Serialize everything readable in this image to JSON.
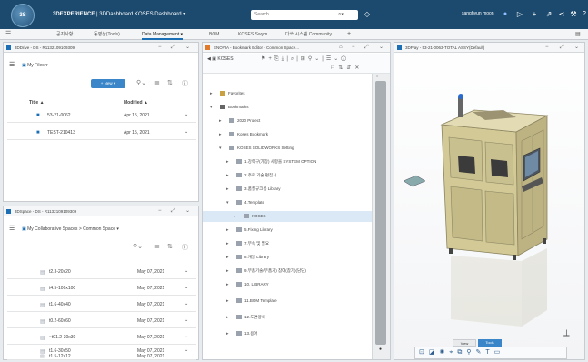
{
  "topbar": {
    "logo_text": "3S",
    "brand_strong": "3DEXPERIENCE",
    "brand_rest": " | 3DDashboard  KOSES Dashboard ▾",
    "search_placeholder": "Search",
    "user_name": "sanghyun moon"
  },
  "tabs": [
    {
      "label": "공지사항"
    },
    {
      "label": "동영상(Tools)"
    },
    {
      "label": "Data Management  ▾"
    },
    {
      "label": "BOM"
    },
    {
      "label": "KOSES Swym"
    },
    {
      "label": "다쏘 시스템 Community"
    },
    {
      "label": "+"
    }
  ],
  "drive_panel": {
    "title": "3DDrive - DS - R1132109109309",
    "files_label": "My Files ▾",
    "new_button": "+ New ▾",
    "col_title": "Title ▲",
    "col_modified": "Modified ▲",
    "rows": [
      {
        "title": "53-21-0062",
        "modified": "Apr 15, 2021"
      },
      {
        "title": "TEST-210413",
        "modified": "Apr 15, 2021"
      }
    ]
  },
  "space_panel": {
    "title": "3DSpace - DS - R1132109109309",
    "breadcrumb": "My Collaborative Spaces > Common Space ▾",
    "rows": [
      {
        "title": "t2.3-20x20",
        "modified": "May 07, 2021"
      },
      {
        "title": "t4.5-100x100",
        "modified": "May 07, 2021"
      },
      {
        "title": "t1.6-40x40",
        "modified": "May 07, 2021"
      },
      {
        "title": "t0.2-60x60",
        "modified": "May 07, 2021"
      },
      {
        "title": "~t01.2-30x30",
        "modified": "May 07, 2021"
      },
      {
        "title": "t1.6-30x50",
        "modified": "May 07, 2021"
      },
      {
        "title": "t1.5-12x12",
        "modified": "May 07, 2021"
      }
    ]
  },
  "enovia_panel": {
    "title": "ENOVIA - Bookmark Editor - Common Space...",
    "tenant": "KOSES",
    "tree": [
      {
        "label": "Favorites",
        "level": 0
      },
      {
        "label": "Bookmarks",
        "level": 0
      },
      {
        "label": "2020 Project",
        "level": 1
      },
      {
        "label": "Koses Bookmark",
        "level": 1
      },
      {
        "label": "KOSES SOLIDWORKS Setting",
        "level": 1
      },
      {
        "label": "1.강력구(가장) 사항을 SYSTEM OPTION",
        "level": 2
      },
      {
        "label": "2.주로 기술 편집시",
        "level": 2
      },
      {
        "label": "3.품질규크름 Library",
        "level": 2
      },
      {
        "label": "4.Template",
        "level": 2
      },
      {
        "label": "KOSES",
        "level": 3,
        "selected": true
      },
      {
        "label": "5.Fixing Library",
        "level": 2
      },
      {
        "label": "7.부속 및 필요",
        "level": 2
      },
      {
        "label": "8.개발 Library",
        "level": 2
      },
      {
        "label": "9.부품기술(부품기) 참여(참가)(담당)",
        "level": 2
      },
      {
        "label": "10. LIBRARY",
        "level": 2
      },
      {
        "label": "11.BOM Template",
        "level": 2
      },
      {
        "label": "12.도면양식",
        "level": 2
      },
      {
        "label": "13.용어",
        "level": 2
      }
    ]
  },
  "play_panel": {
    "title": "3DPlay - 53-21-0063-TOTAL ASSY(Default)",
    "view_tab": "View",
    "tools_tab": "Tools"
  },
  "colors": {
    "topbar": "#1c4a6e",
    "accent": "#1c6fb4",
    "selection": "#dbe9f6"
  }
}
